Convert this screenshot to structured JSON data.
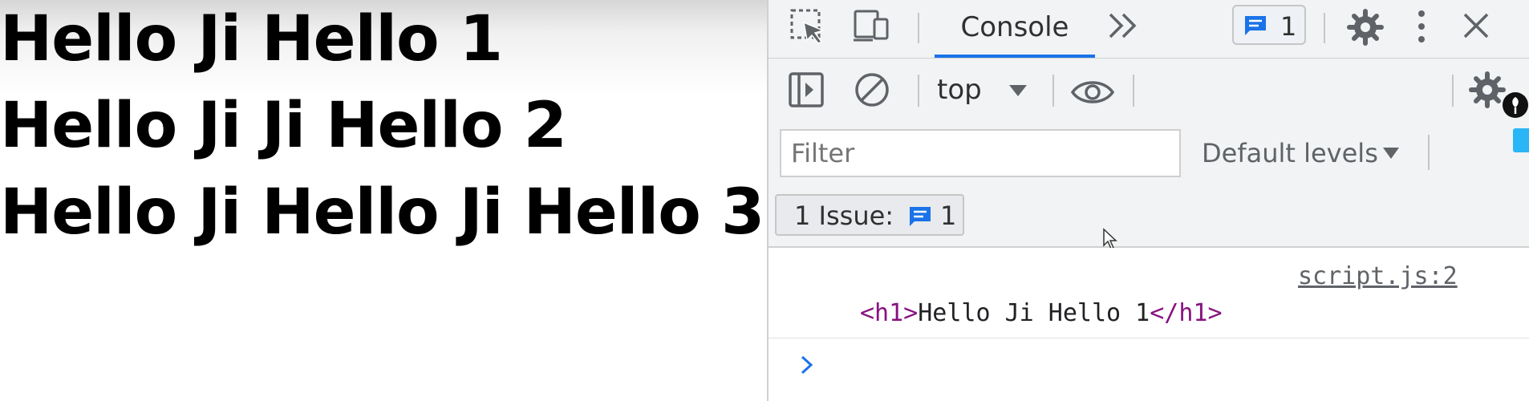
{
  "page": {
    "headings": [
      "Hello Ji Hello 1",
      "Hello Ji Ji Hello 2",
      "Hello Ji Hello Ji Hello 3"
    ]
  },
  "devtools": {
    "tabs": {
      "active": "Console"
    },
    "message_badge_count": "1",
    "toolbar": {
      "context": "top"
    },
    "filter": {
      "placeholder": "Filter"
    },
    "levels": "Default levels",
    "issues": {
      "label": "1 Issue:",
      "count": "1"
    },
    "console": {
      "source": "script.js:2",
      "tag_open": "<h1>",
      "text": "Hello Ji Hello 1",
      "tag_close": "</h1>"
    },
    "colors": {
      "accent": "#1a73e8",
      "tag": "#881280"
    }
  }
}
